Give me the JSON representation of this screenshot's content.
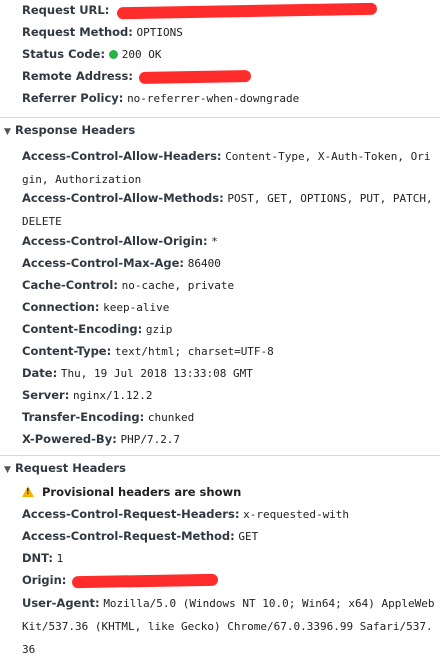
{
  "general": [
    {
      "name": "Request URL:",
      "value": ""
    },
    {
      "name": "Request Method:",
      "value": "OPTIONS"
    },
    {
      "name": "Status Code:",
      "value": "200 OK"
    },
    {
      "name": "Remote Address:",
      "value": ""
    },
    {
      "name": "Referrer Policy:",
      "value": "no-referrer-when-downgrade"
    }
  ],
  "response": {
    "title": "Response Headers",
    "headers": [
      {
        "name": "Access-Control-Allow-Headers:",
        "value": "Content-Type, X-Auth-Token, Origin, Authorization"
      },
      {
        "name": "Access-Control-Allow-Methods:",
        "value": "POST, GET, OPTIONS, PUT, PATCH, DELETE"
      },
      {
        "name": "Access-Control-Allow-Origin:",
        "value": "*"
      },
      {
        "name": "Access-Control-Max-Age:",
        "value": "86400"
      },
      {
        "name": "Cache-Control:",
        "value": "no-cache, private"
      },
      {
        "name": "Connection:",
        "value": "keep-alive"
      },
      {
        "name": "Content-Encoding:",
        "value": "gzip"
      },
      {
        "name": "Content-Type:",
        "value": "text/html; charset=UTF-8"
      },
      {
        "name": "Date:",
        "value": "Thu, 19 Jul 2018 13:33:08 GMT"
      },
      {
        "name": "Server:",
        "value": "nginx/1.12.2"
      },
      {
        "name": "Transfer-Encoding:",
        "value": "chunked"
      },
      {
        "name": "X-Powered-By:",
        "value": "PHP/7.2.7"
      }
    ]
  },
  "request": {
    "title": "Request Headers",
    "warning": "Provisional headers are shown",
    "headers": [
      {
        "name": "Access-Control-Request-Headers:",
        "value": "x-requested-with"
      },
      {
        "name": "Access-Control-Request-Method:",
        "value": "GET"
      },
      {
        "name": "DNT:",
        "value": "1"
      },
      {
        "name": "Origin:",
        "value": ""
      },
      {
        "name": "User-Agent:",
        "value": "Mozilla/5.0 (Windows NT 10.0; Win64; x64) AppleWebKit/537.36 (KHTML, like Gecko) Chrome/67.0.3396.99 Safari/537.36"
      }
    ]
  },
  "colors": {
    "status_ok": "#26b545",
    "redaction": "#ff1a1a",
    "warning": "#f2b400"
  }
}
